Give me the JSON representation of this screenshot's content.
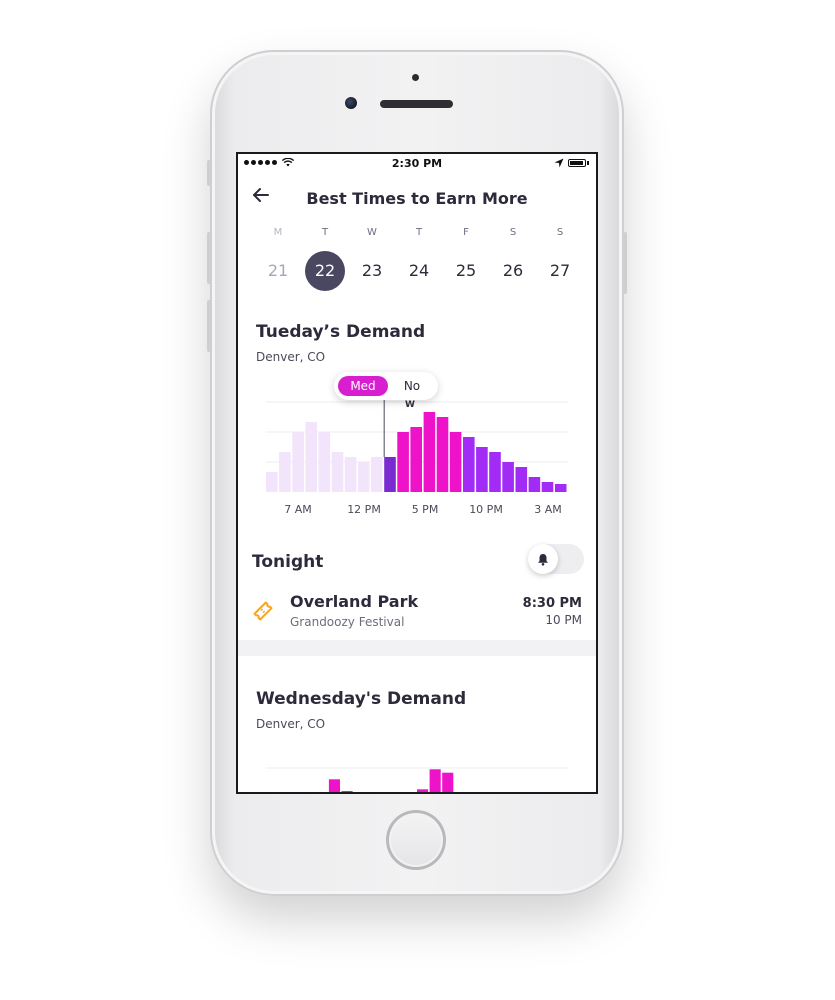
{
  "status_bar": {
    "time": "2:30 PM"
  },
  "header": {
    "title": "Best Times to Earn More",
    "back_icon": "arrow-left-icon"
  },
  "week": {
    "days": [
      {
        "letter": "M",
        "date": "21",
        "state": "past"
      },
      {
        "letter": "T",
        "date": "22",
        "state": "selected"
      },
      {
        "letter": "W",
        "date": "23",
        "state": "normal"
      },
      {
        "letter": "T",
        "date": "24",
        "state": "normal"
      },
      {
        "letter": "F",
        "date": "25",
        "state": "normal"
      },
      {
        "letter": "S",
        "date": "26",
        "state": "normal"
      },
      {
        "letter": "S",
        "date": "27",
        "state": "normal"
      }
    ]
  },
  "demand_today": {
    "title": "Tueday’s Demand",
    "location": "Denver, CO",
    "tooltip": {
      "selected": "Med",
      "other": "No"
    },
    "marker": "W",
    "x_labels": [
      "7 AM",
      "12 PM",
      "5 PM",
      "10 PM",
      "3 AM"
    ]
  },
  "chart_data": {
    "type": "bar",
    "past_values": [
      2,
      4,
      6,
      7,
      6,
      4,
      3.5,
      3,
      3.5
    ],
    "current_value": 3.5,
    "future_values": [
      6,
      6.5,
      8,
      7.5,
      6,
      5.5,
      4.5,
      4,
      3,
      2.5,
      1.5,
      1,
      0.8
    ],
    "ymax": 9,
    "colors": {
      "past": "#f2e4fa",
      "current": "#7a2bcf",
      "high": "#ee12c9",
      "low": "#a22cf5"
    }
  },
  "tonight": {
    "title": "Tonight",
    "toggle_icon": "bell-icon",
    "event": {
      "icon": "ticket-icon",
      "name": "Overland Park",
      "subtitle": "Grandoozy Festival",
      "start": "8:30 PM",
      "end": "10 PM"
    }
  },
  "demand_next": {
    "title": "Wednesday's Demand",
    "location": "Denver, CO"
  },
  "preview_chart": {
    "values": [
      0,
      0,
      0,
      0,
      0,
      1,
      0.3,
      0,
      0,
      0,
      0,
      0,
      0.4,
      1.6,
      1.4,
      0,
      0,
      0,
      0,
      0,
      0,
      0,
      0,
      0
    ],
    "ymax": 1.8
  }
}
